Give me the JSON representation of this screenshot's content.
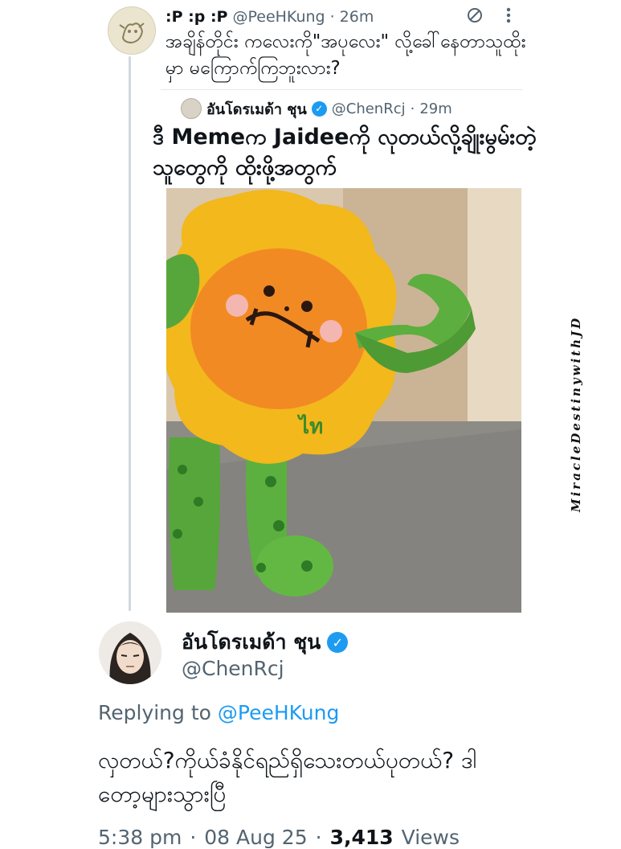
{
  "reply_tweet": {
    "display_name": ":P :p :P",
    "handle": "@PeeHKung",
    "time": "26m",
    "text": "အချိန်တိုင်း ကလေးကို\"အပုလေး\" လို့ခေါ်နေတာသူထိုးမှာ မကြောက်ကြဘူးလား?",
    "icons": {
      "blocked": "no-sign-icon",
      "more": "more-vertical-icon"
    }
  },
  "quoted_tweet": {
    "display_name": "อันโดรเมด้า ชุน",
    "handle": "@ChenRcj",
    "time": "29m",
    "text": "ဒီ Memeက Jaideeကို လုတယ်လို့ချိုးမွမ်းတဲ့သူတွေကို ထိုးဖို့အတွက်",
    "mascot_logo_text": "ไท"
  },
  "main_tweet": {
    "display_name": "อันโดรเมด้า ชุน",
    "handle": "@ChenRcj",
    "replying_prefix": "Replying to",
    "replying_to": "@PeeHKung",
    "text": "လှတယ်?ကိုယ်ခံနိုင်ရည်ရှိသေးတယ်ပုတယ်? ဒါတော့များသွားပြီ",
    "time": "5:38 pm",
    "date": "08 Aug 25",
    "views_count": "3,413",
    "views_label": "Views"
  },
  "watermark": "MiracleDestinywithJD",
  "separator": "·",
  "colors": {
    "text": "#0f1419",
    "secondary": "#536471",
    "link": "#1d9bf0",
    "verified": "#1d9bf0"
  }
}
